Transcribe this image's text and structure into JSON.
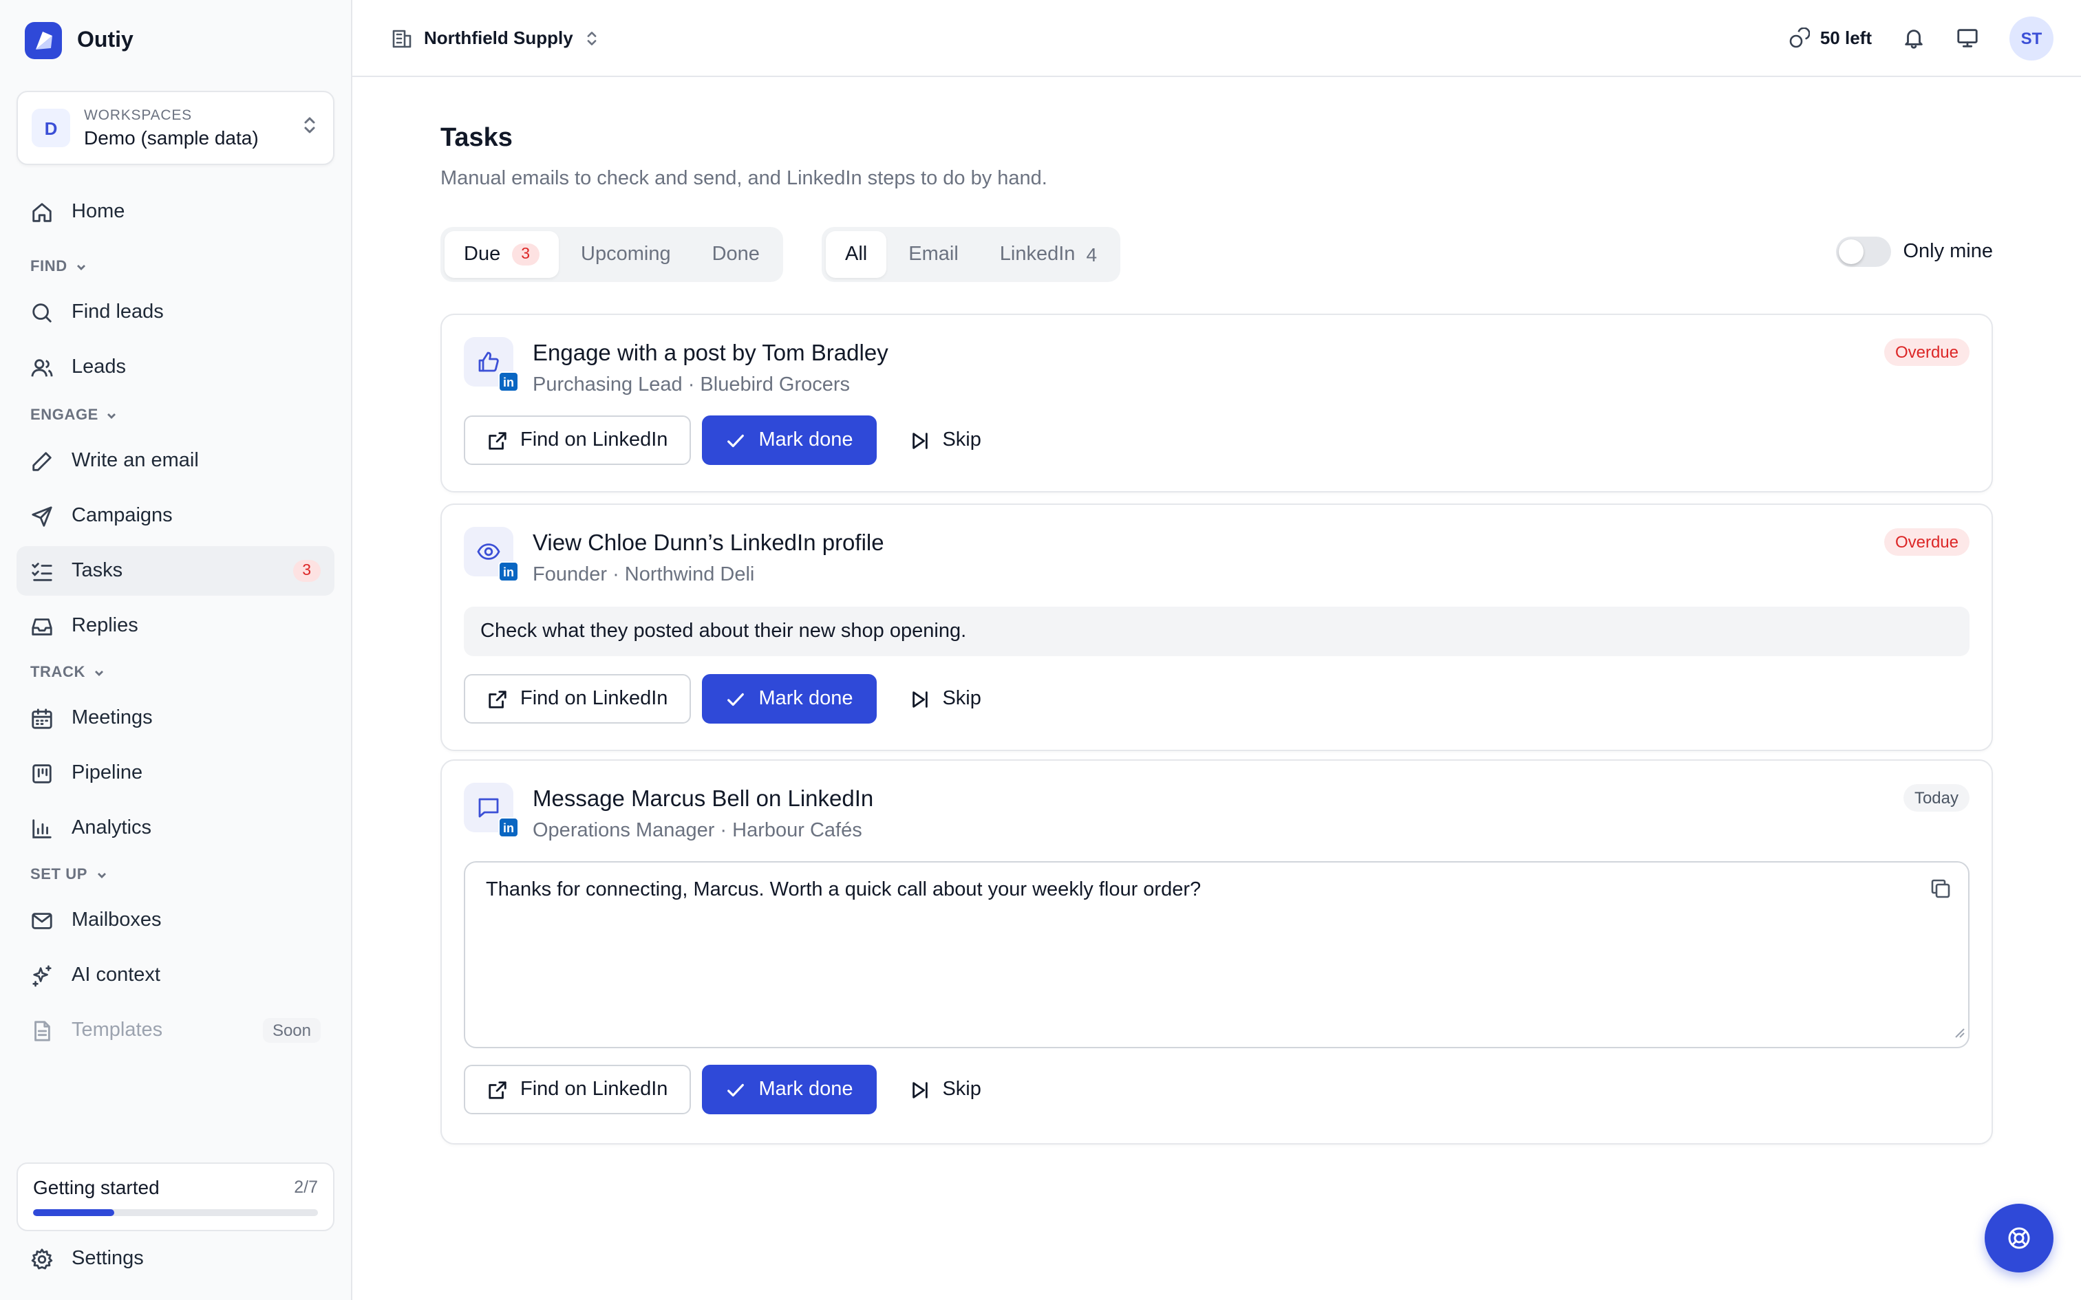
{
  "app": {
    "name": "Outiy"
  },
  "workspace": {
    "caption": "WORKSPACES",
    "name": "Demo (sample data)",
    "initial": "D"
  },
  "nav": {
    "home": "Home",
    "find_section": "FIND",
    "find_leads": "Find leads",
    "leads": "Leads",
    "engage_section": "ENGAGE",
    "write_email": "Write an email",
    "campaigns": "Campaigns",
    "tasks": "Tasks",
    "tasks_badge": "3",
    "replies": "Replies",
    "track_section": "TRACK",
    "meetings": "Meetings",
    "pipeline": "Pipeline",
    "analytics": "Analytics",
    "setup_section": "SET UP",
    "mailboxes": "Mailboxes",
    "ai_context": "AI context",
    "templates": "Templates",
    "templates_tag": "Soon",
    "settings": "Settings"
  },
  "getting_started": {
    "title": "Getting started",
    "count": "2/7",
    "progress": 0.2857
  },
  "topbar": {
    "org": "Northfield Supply",
    "credits": "50 left",
    "user_initials": "ST"
  },
  "page": {
    "title": "Tasks",
    "subtitle": "Manual emails to check and send, and LinkedIn steps to do by hand."
  },
  "filters": {
    "due": "Due",
    "due_count": "3",
    "upcoming": "Upcoming",
    "done": "Done",
    "all": "All",
    "email": "Email",
    "linkedin": "LinkedIn",
    "linkedin_count": "4",
    "only_mine": "Only mine",
    "only_mine_on": false
  },
  "actions": {
    "find": "Find on LinkedIn",
    "done": "Mark done",
    "skip": "Skip"
  },
  "tasks": [
    {
      "title": "Engage with a post by Tom Bradley",
      "subtitle": "Purchasing Lead · Bluebird Grocers",
      "status": "Overdue",
      "icon": "thumbs-up-icon"
    },
    {
      "title": "View Chloe Dunn’s LinkedIn profile",
      "subtitle": "Founder · Northwind Deli",
      "status": "Overdue",
      "icon": "eye-icon",
      "note": "Check what they posted about their new shop opening."
    },
    {
      "title": "Message Marcus Bell on LinkedIn",
      "subtitle": "Operations Manager · Harbour Cafés",
      "status": "Today",
      "icon": "message-icon",
      "message": "Thanks for connecting, Marcus. Worth a quick call about your weekly flour order?"
    }
  ],
  "colors": {
    "accent": "#2f49d8",
    "overdue": "#dc2626",
    "linkedin": "#0a66c2"
  }
}
